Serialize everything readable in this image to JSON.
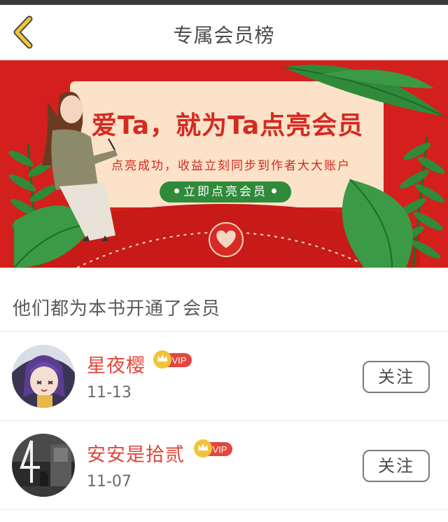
{
  "header": {
    "title": "专属会员榜",
    "back_icon": "chevron-left-icon",
    "accent_color": "#e8b82e"
  },
  "banner": {
    "headline": "爱Ta，就为Ta点亮会员",
    "subtitle": "点亮成功，收益立刻同步到作者大大账户",
    "button_label": "立即点亮会员",
    "background_color": "#d3201c",
    "card_color": "#fbe2c8"
  },
  "members_section": {
    "title": "他们都为本书开通了会员"
  },
  "members": [
    {
      "name": "星夜樱",
      "badge": "VIP",
      "date": "11-13",
      "follow_label": "关注"
    },
    {
      "name": "安安是拾贰",
      "badge": "VIP",
      "date": "11-07",
      "follow_label": "关注"
    }
  ]
}
